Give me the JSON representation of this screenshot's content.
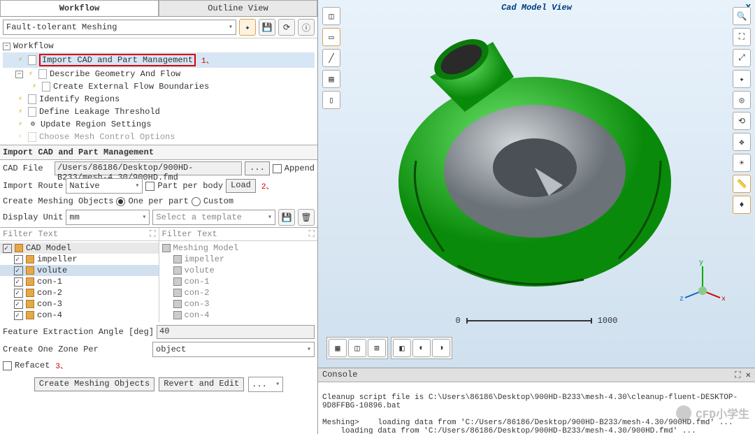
{
  "tabs": {
    "workflow": "Workflow",
    "outline": "Outline View"
  },
  "preset": "Fault-tolerant Meshing",
  "tree": {
    "root": "Workflow",
    "items": [
      "Import CAD and Part Management",
      "Describe Geometry And Flow",
      "Create External Flow Boundaries",
      "Identify Regions",
      "Define Leakage Threshold",
      "Update Region Settings",
      "Choose Mesh Control Options"
    ]
  },
  "annot": {
    "a1": "1、",
    "a2": "2、",
    "a3": "3、"
  },
  "section_title": "Import CAD and Part Management",
  "form": {
    "cad_file_label": "CAD File",
    "cad_file_value": "/Users/86186/Desktop/900HD-B233/mesh-4.30/900HD.fmd",
    "browse": "...",
    "append": "Append",
    "import_route_label": "Import Route",
    "import_route_value": "Native",
    "part_per_body": "Part per body",
    "load": "Load",
    "create_objs_label": "Create Meshing Objects",
    "opt_one": "One per part",
    "opt_custom": "Custom",
    "display_unit_label": "Display Unit",
    "display_unit_value": "mm",
    "template_placeholder": "Select a template",
    "filter_text": "Filter Text"
  },
  "cad_model": {
    "header": "CAD Model",
    "items": [
      "impeller",
      "volute",
      "con-1",
      "con-2",
      "con-3",
      "con-4"
    ]
  },
  "meshing_model": {
    "header": "Meshing Model",
    "items": [
      "impeller",
      "volute",
      "con-1",
      "con-2",
      "con-3",
      "con-4"
    ]
  },
  "bottom": {
    "angle_label": "Feature Extraction Angle [deg]",
    "angle_value": "40",
    "zone_label": "Create One Zone Per",
    "zone_value": "object",
    "refacet": "Refacet",
    "create_btn": "Create Meshing Objects",
    "revert_btn": "Revert and Edit",
    "more": "..."
  },
  "viewer": {
    "title": "Cad Model View",
    "scale_min": "0",
    "scale_max": "1000",
    "axis_x": "x",
    "axis_y": "y",
    "axis_z": "z"
  },
  "console": {
    "title": "Console",
    "line1": "Cleanup script file is C:\\Users\\86186\\Desktop\\900HD-B233\\mesh-4.30\\cleanup-fluent-DESKTOP-9D8FFBG-10896.bat",
    "line2": "Meshing>    loading data from 'C:/Users/86186/Desktop/900HD-B233/mesh-4.30/900HD.fmd' ...",
    "line3": "    loading data from 'C:/Users/86186/Desktop/900HD-B233/mesh-4.30/900HD.fmd' ..."
  },
  "watermark": "CFD小学生",
  "colors": {
    "model_green": "#2bbf2b",
    "model_grey": "#9aa1a7",
    "accent_red": "#d00000"
  }
}
